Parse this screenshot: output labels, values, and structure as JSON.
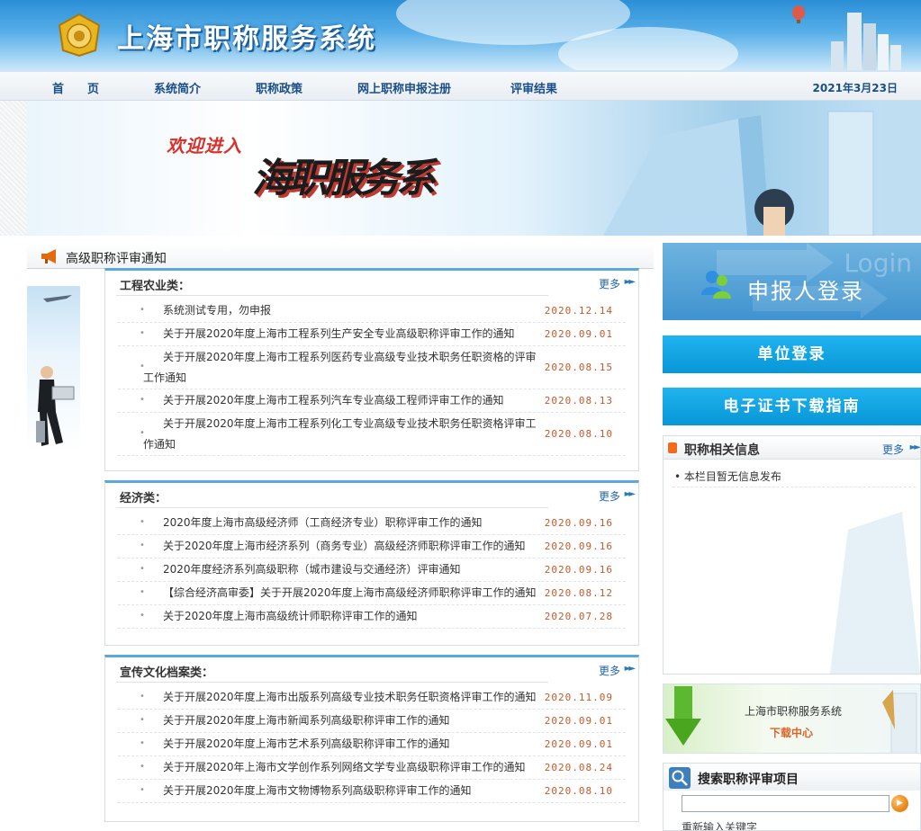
{
  "header": {
    "site_title": "上海市职称服务系统"
  },
  "nav": {
    "items": [
      {
        "label": "首　　页"
      },
      {
        "label": "系统简介"
      },
      {
        "label": "职称政策"
      },
      {
        "label": "网上职称申报注册"
      },
      {
        "label": "评审结果"
      }
    ],
    "date": "2021年3月23日"
  },
  "banner": {
    "welcome": "欢迎进入",
    "logo_text": "海职服务系"
  },
  "notices": {
    "section_title": "高级职称评审通知",
    "more_label": "更多",
    "categories": [
      {
        "title": "工程农业类：",
        "items": [
          {
            "text": "系统测试专用，勿申报",
            "date": "2020.12.14"
          },
          {
            "text": "关于开展2020年度上海市工程系列生产安全专业高级职称评审工作的通知",
            "date": "2020.09.01"
          },
          {
            "text": "关于开展2020年度上海市工程系列医药专业高级专业技术职务任职资格的评审工作通知",
            "date": "2020.08.15"
          },
          {
            "text": "关于开展2020年度上海市工程系列汽车专业高级工程师评审工作的通知",
            "date": "2020.08.13"
          },
          {
            "text": "关于开展2020年度上海市工程系列化工专业高级专业技术职务任职资格评审工作通知",
            "date": "2020.08.10"
          }
        ]
      },
      {
        "title": "经济类：",
        "items": [
          {
            "text": "2020年度上海市高级经济师（工商经济专业）职称评审工作的通知",
            "date": "2020.09.16"
          },
          {
            "text": "关于2020年度上海市经济系列（商务专业）高级经济师职称评审工作的通知",
            "date": "2020.09.16"
          },
          {
            "text": "2020年度经济系列高级职称（城市建设与交通经济）评审通知",
            "date": "2020.09.16"
          },
          {
            "text": "【综合经济高审委】关于开展2020年度上海市高级经济师职称评审工作的通知",
            "date": "2020.08.12"
          },
          {
            "text": "关于2020年度上海市高级统计师职称评审工作的通知",
            "date": "2020.07.28"
          }
        ]
      },
      {
        "title": "宣传文化档案类：",
        "items": [
          {
            "text": "关于开展2020年度上海市出版系列高级专业技术职务任职资格评审工作的通知",
            "date": "2020.11.09"
          },
          {
            "text": "关于开展2020年度上海市新闻系列高级职称评审工作的通知",
            "date": "2020.09.01"
          },
          {
            "text": "关于开展2020年度上海市艺术系列高级职称评审工作的通知",
            "date": "2020.09.01"
          },
          {
            "text": "关于开展2020年上海市文学创作系列网络文学专业高级职称评审工作的通知",
            "date": "2020.08.24"
          },
          {
            "text": "关于开展2020年度上海市文物博物系列高级职称评审工作的通知",
            "date": "2020.08.10"
          }
        ]
      }
    ]
  },
  "sidebar": {
    "login_label": "申报人登录",
    "login_ghost": "Login",
    "unit_login_label": "单位登录",
    "cert_guide_label": "电子证书下载指南",
    "info": {
      "title": "职称相关信息",
      "more_label": "更多",
      "empty_text": "本栏目暂无信息发布"
    },
    "download": {
      "name": "上海市职称服务系统",
      "sub": "下载中心"
    },
    "search": {
      "title": "搜索职称评审项目",
      "value": "",
      "hint": "重新输入关键字"
    }
  }
}
